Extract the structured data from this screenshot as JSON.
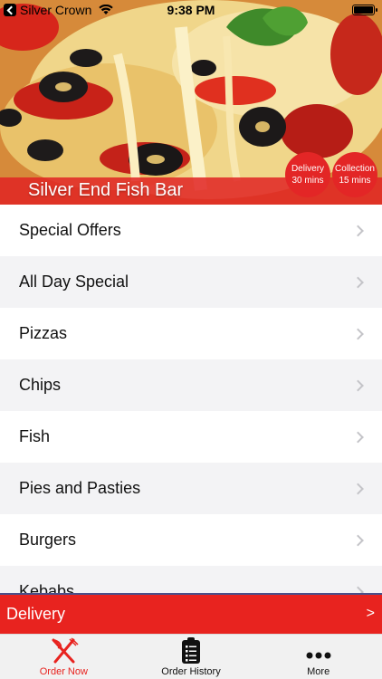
{
  "status_bar": {
    "carrier": "Silver Crown",
    "time": "9:38 PM",
    "battery_percent": 100
  },
  "hero": {
    "title": "Silver End Fish Bar",
    "delivery_badge": {
      "line1": "Delivery",
      "line2": "30 mins"
    },
    "collection_badge": {
      "line1": "Collection",
      "line2": "15 mins"
    }
  },
  "menu": {
    "items": [
      {
        "label": "Special Offers"
      },
      {
        "label": "All Day Special"
      },
      {
        "label": "Pizzas"
      },
      {
        "label": "Chips"
      },
      {
        "label": "Fish"
      },
      {
        "label": "Pies and Pasties"
      },
      {
        "label": "Burgers"
      },
      {
        "label": "Kebabs"
      }
    ]
  },
  "order_mode": {
    "label": "Delivery",
    "arrow": ">"
  },
  "tabs": [
    {
      "label": "Order Now",
      "icon": "fork-knife-icon",
      "active": true
    },
    {
      "label": "Order History",
      "icon": "clipboard-list-icon",
      "active": false
    },
    {
      "label": "More",
      "icon": "ellipsis-icon",
      "active": false
    }
  ],
  "colors": {
    "accent_red": "#e8231f",
    "tab_bar_bg": "#f1f1f1",
    "list_alt_bg": "#f3f3f5"
  }
}
